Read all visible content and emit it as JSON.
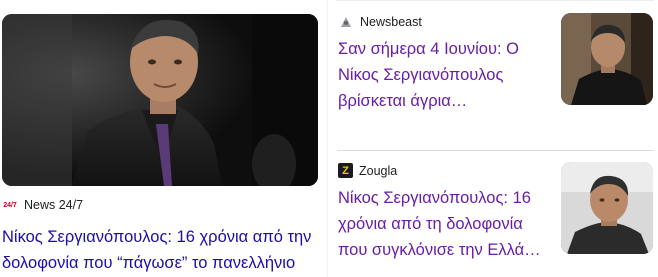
{
  "main_card": {
    "source_name": "News 24/7",
    "source_logo_text": "24/7",
    "source_logo_color": "#d0021b",
    "headline": "Νίκος Σεργιανόπουλος: 16 χρόνια από την δολοφονία που “πάγωσε” το πανελλήνιο"
  },
  "side_cards": [
    {
      "source_name": "Newsbeast",
      "source_icon": "newsbeast-logo-icon",
      "headline": "Σαν σήμερα 4 Ιουνίου: Ο Νίκος Σεργιανόπουλος βρίσκεται άγρια…"
    },
    {
      "source_name": "Zougla",
      "source_logo_text": "Z",
      "source_logo_bg": "#1b1b1b",
      "source_logo_color": "#f5c400",
      "headline": "Νίκος Σεργιανόπουλος: 16 χρόνια από τη δολοφονία που συγκλόνισε την Ελλά…"
    }
  ],
  "colors": {
    "link": "#1a0dab",
    "visited_link": "#681da8"
  }
}
